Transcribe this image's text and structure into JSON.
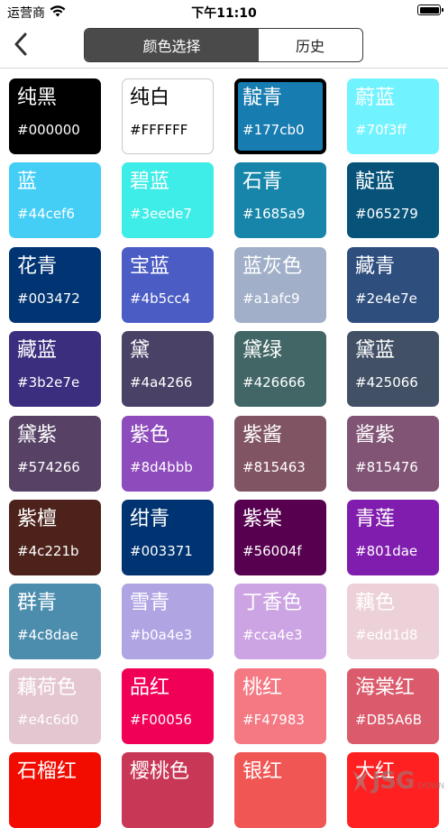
{
  "status_bar": {
    "carrier": "运营商",
    "time": "下午11:10"
  },
  "nav": {
    "segments": [
      "颜色选择",
      "历史"
    ]
  },
  "colors": [
    {
      "name": "纯黑",
      "hex": "#000000",
      "bg": "#000000",
      "text": "light"
    },
    {
      "name": "纯白",
      "hex": "#FFFFFF",
      "bg": "#FFFFFF",
      "text": "dark",
      "white": true
    },
    {
      "name": "靛青",
      "hex": "#177cb0",
      "bg": "#177cb0",
      "text": "light",
      "selected": true
    },
    {
      "name": "蔚蓝",
      "hex": "#70f3ff",
      "bg": "#70f3ff",
      "text": "light"
    },
    {
      "name": "蓝",
      "hex": "#44cef6",
      "bg": "#44cef6",
      "text": "light"
    },
    {
      "name": "碧蓝",
      "hex": "#3eede7",
      "bg": "#3eede7",
      "text": "light"
    },
    {
      "name": "石青",
      "hex": "#1685a9",
      "bg": "#1685a9",
      "text": "light"
    },
    {
      "name": "靛蓝",
      "hex": "#065279",
      "bg": "#065279",
      "text": "light"
    },
    {
      "name": "花青",
      "hex": "#003472",
      "bg": "#003472",
      "text": "light"
    },
    {
      "name": "宝蓝",
      "hex": "#4b5cc4",
      "bg": "#4b5cc4",
      "text": "light"
    },
    {
      "name": "蓝灰色",
      "hex": "#a1afc9",
      "bg": "#a1afc9",
      "text": "light"
    },
    {
      "name": "藏青",
      "hex": "#2e4e7e",
      "bg": "#2e4e7e",
      "text": "light"
    },
    {
      "name": "藏蓝",
      "hex": "#3b2e7e",
      "bg": "#3b2e7e",
      "text": "light"
    },
    {
      "name": "黛",
      "hex": "#4a4266",
      "bg": "#4a4266",
      "text": "light"
    },
    {
      "name": "黛绿",
      "hex": "#426666",
      "bg": "#426666",
      "text": "light"
    },
    {
      "name": "黛蓝",
      "hex": "#425066",
      "bg": "#425066",
      "text": "light"
    },
    {
      "name": "黛紫",
      "hex": "#574266",
      "bg": "#574266",
      "text": "light"
    },
    {
      "name": "紫色",
      "hex": "#8d4bbb",
      "bg": "#8d4bbb",
      "text": "light"
    },
    {
      "name": "紫酱",
      "hex": "#815463",
      "bg": "#815463",
      "text": "light"
    },
    {
      "name": "酱紫",
      "hex": "#815476",
      "bg": "#815476",
      "text": "light"
    },
    {
      "name": "紫檀",
      "hex": "#4c221b",
      "bg": "#4c221b",
      "text": "light"
    },
    {
      "name": "绀青",
      "hex": "#003371",
      "bg": "#003371",
      "text": "light"
    },
    {
      "name": "紫棠",
      "hex": "#56004f",
      "bg": "#56004f",
      "text": "light"
    },
    {
      "name": "青莲",
      "hex": "#801dae",
      "bg": "#801dae",
      "text": "light"
    },
    {
      "name": "群青",
      "hex": "#4c8dae",
      "bg": "#4c8dae",
      "text": "light"
    },
    {
      "name": "雪青",
      "hex": "#b0a4e3",
      "bg": "#b0a4e3",
      "text": "light"
    },
    {
      "name": "丁香色",
      "hex": "#cca4e3",
      "bg": "#cca4e3",
      "text": "light"
    },
    {
      "name": "藕色",
      "hex": "#edd1d8",
      "bg": "#edd1d8",
      "text": "light"
    },
    {
      "name": "藕荷色",
      "hex": "#e4c6d0",
      "bg": "#e4c6d0",
      "text": "light"
    },
    {
      "name": "品红",
      "hex": "#F00056",
      "bg": "#F00056",
      "text": "light"
    },
    {
      "name": "桃红",
      "hex": "#F47983",
      "bg": "#F47983",
      "text": "light"
    },
    {
      "name": "海棠红",
      "hex": "#DB5A6B",
      "bg": "#DB5A6B",
      "text": "light"
    },
    {
      "name": "石榴红",
      "hex": "",
      "bg": "#f20c00",
      "text": "light"
    },
    {
      "name": "樱桃色",
      "hex": "",
      "bg": "#c93756",
      "text": "light"
    },
    {
      "name": "银红",
      "hex": "",
      "bg": "#f05654",
      "text": "light"
    },
    {
      "name": "大红",
      "hex": "",
      "bg": "#ff2121",
      "text": "light"
    }
  ],
  "watermark": {
    "text": "JSG",
    "sub": "DOWN"
  }
}
